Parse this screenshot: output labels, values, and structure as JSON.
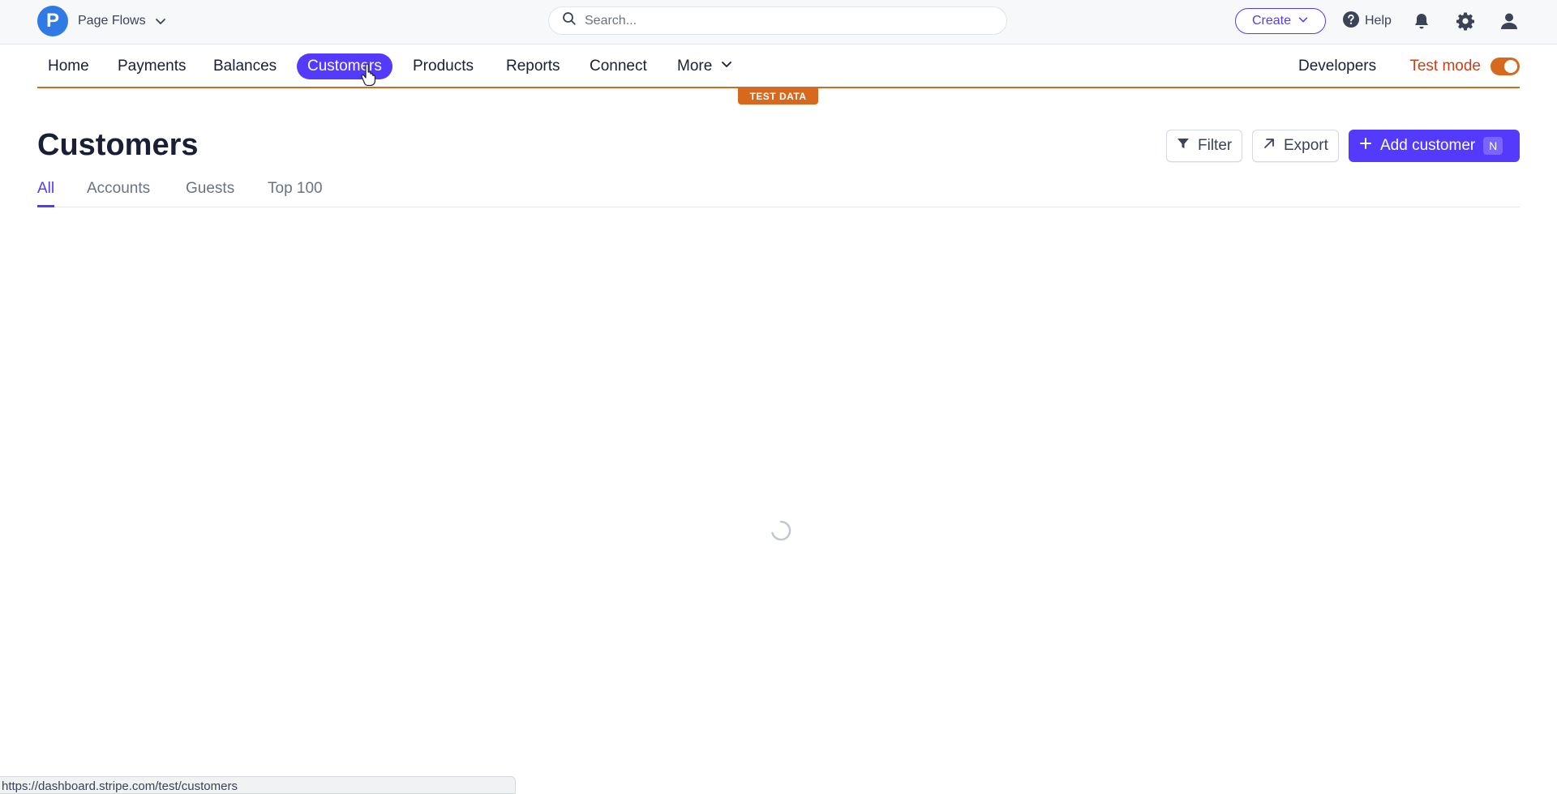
{
  "account": {
    "logo_letter": "P",
    "name": "Page Flows"
  },
  "search": {
    "placeholder": "Search..."
  },
  "top_actions": {
    "create_label": "Create",
    "help_label": "Help"
  },
  "nav": {
    "items": [
      "Home",
      "Payments",
      "Balances",
      "Customers",
      "Products",
      "Reports",
      "Connect",
      "More"
    ],
    "active": "Customers",
    "developers_label": "Developers",
    "test_mode_label": "Test mode",
    "test_mode_on": true
  },
  "test_badge": "TEST DATA",
  "page": {
    "title": "Customers",
    "filter_label": "Filter",
    "export_label": "Export",
    "add_label": "Add customer",
    "add_shortcut": "N"
  },
  "tabs": {
    "items": [
      "All",
      "Accounts",
      "Guests",
      "Top 100"
    ],
    "active": "All"
  },
  "status_bar": {
    "url": "https://dashboard.stripe.com/test/customers"
  },
  "colors": {
    "accent": "#533afd",
    "test_mode": "#d6691d",
    "logo": "#2f7ae5"
  },
  "icons": {
    "account_chevron": "chevron-down-icon",
    "search": "search-icon",
    "help": "help-circle-icon",
    "notifications": "bell-icon",
    "settings": "gear-icon",
    "profile": "user-icon",
    "filter": "filter-icon",
    "export": "arrow-up-right-icon",
    "add": "plus-icon",
    "loading": "spinner-icon"
  }
}
